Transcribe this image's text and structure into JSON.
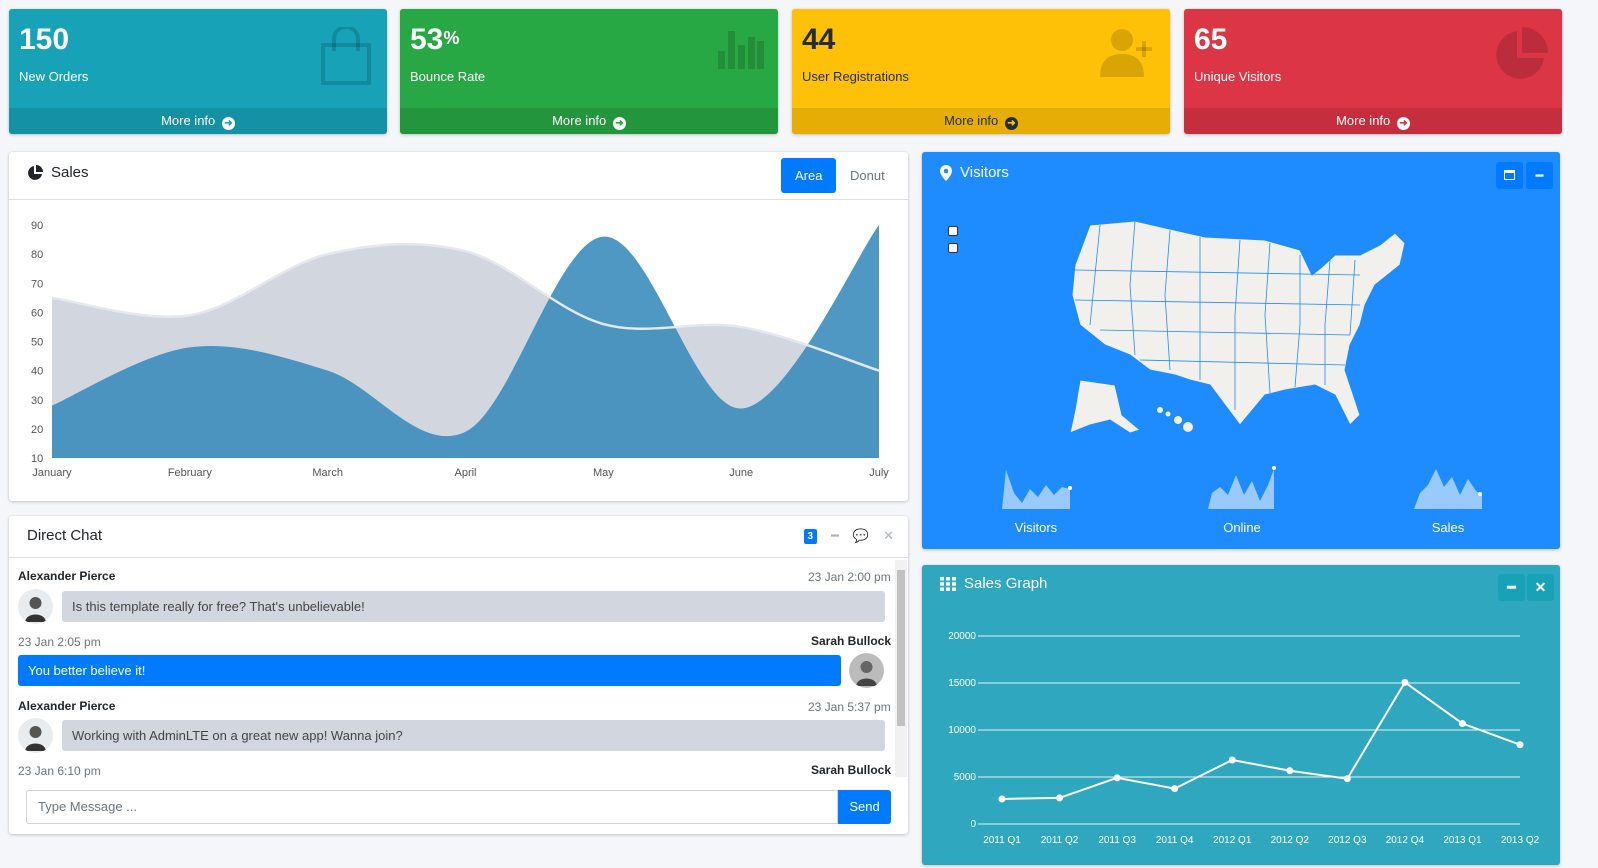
{
  "stat_boxes": [
    {
      "value": "150",
      "suffix": "",
      "label": "New Orders",
      "link": "More info",
      "icon": "shopping-bag-icon",
      "color": "#17a2b8"
    },
    {
      "value": "53",
      "suffix": "%",
      "label": "Bounce Rate",
      "link": "More info",
      "icon": "bar-chart-icon",
      "color": "#28a745"
    },
    {
      "value": "44",
      "suffix": "",
      "label": "User Registrations",
      "link": "More info",
      "icon": "user-plus-icon",
      "color": "#ffc107"
    },
    {
      "value": "65",
      "suffix": "",
      "label": "Unique Visitors",
      "link": "More info",
      "icon": "pie-chart-icon",
      "color": "#dc3545"
    }
  ],
  "sales": {
    "title": "Sales",
    "tabs": [
      "Area",
      "Donut"
    ],
    "active_tab": "Area"
  },
  "chat": {
    "title": "Direct Chat",
    "badge": "3",
    "messages": [
      {
        "name": "Alexander Pierce",
        "time": "23 Jan 2:00 pm",
        "text": "Is this template really for free? That's unbelievable!",
        "side": "left"
      },
      {
        "name": "Sarah Bullock",
        "time": "23 Jan 2:05 pm",
        "text": "You better believe it!",
        "side": "right"
      },
      {
        "name": "Alexander Pierce",
        "time": "23 Jan 5:37 pm",
        "text": "Working with AdminLTE on a great new app! Wanna join?",
        "side": "left"
      },
      {
        "name": "Sarah Bullock",
        "time": "23 Jan 6:10 pm",
        "text": "",
        "side": "right"
      }
    ],
    "input_placeholder": "Type Message ...",
    "send_label": "Send"
  },
  "visitors": {
    "title": "Visitors",
    "sparklines": [
      "Visitors",
      "Online",
      "Sales"
    ],
    "map_label": "United States map"
  },
  "sales_graph": {
    "title": "Sales Graph"
  },
  "chart_data": [
    {
      "type": "area",
      "title": "",
      "categories": [
        "January",
        "February",
        "March",
        "April",
        "May",
        "June",
        "July"
      ],
      "ylim": [
        10,
        90
      ],
      "yticks": [
        10,
        20,
        30,
        40,
        50,
        60,
        70,
        80,
        90
      ],
      "series": [
        {
          "values": [
            65,
            59,
            80,
            81,
            56,
            55,
            40
          ],
          "color": "#d2d6de"
        },
        {
          "values": [
            28,
            48,
            40,
            19,
            86,
            27,
            90
          ],
          "color": "#3c8dbc"
        }
      ],
      "grid": false
    },
    {
      "type": "line",
      "title": "",
      "categories": [
        "2011 Q1",
        "2011 Q2",
        "2011 Q3",
        "2011 Q4",
        "2012 Q1",
        "2012 Q2",
        "2012 Q3",
        "2012 Q4",
        "2013 Q1",
        "2013 Q2"
      ],
      "values": [
        2666,
        2778,
        4912,
        3767,
        6810,
        5670,
        4820,
        15073,
        10687,
        8432
      ],
      "ylim": [
        0,
        20000
      ],
      "yticks": [
        0,
        5000,
        10000,
        15000,
        20000
      ],
      "grid": true,
      "color": "#ffffff"
    }
  ]
}
